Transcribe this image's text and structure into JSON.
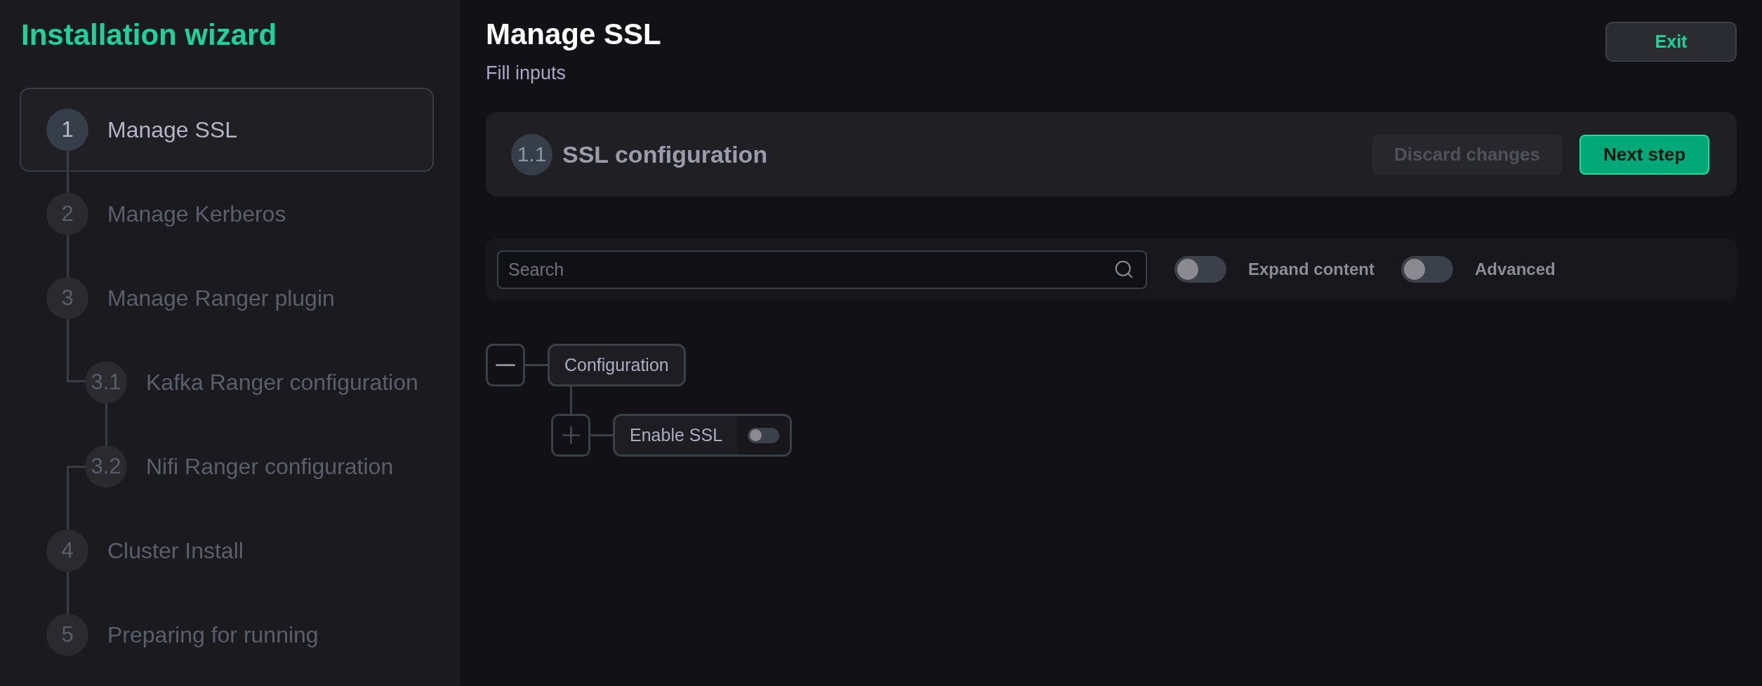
{
  "sidebar": {
    "title": "Installation wizard",
    "steps": [
      {
        "number": "1",
        "label": "Manage SSL",
        "selected": true
      },
      {
        "number": "2",
        "label": "Manage Kerberos",
        "selected": false
      },
      {
        "number": "3",
        "label": "Manage Ranger plugin",
        "selected": false,
        "children": [
          {
            "number": "3.1",
            "label": "Kafka Ranger configuration",
            "selected": false
          },
          {
            "number": "3.2",
            "label": "Nifi Ranger configuration",
            "selected": false
          }
        ]
      },
      {
        "number": "4",
        "label": "Cluster Install",
        "selected": false
      },
      {
        "number": "5",
        "label": "Preparing for running",
        "selected": false
      }
    ]
  },
  "header": {
    "title": "Manage SSL",
    "subtitle": "Fill inputs",
    "exit_button": "Exit"
  },
  "step_card": {
    "number": "1.1",
    "title": "SSL configuration",
    "discard_button": {
      "label": "Discard changes",
      "disabled": true
    },
    "next_button": {
      "label": "Next step",
      "disabled": false
    }
  },
  "filter_bar": {
    "search": {
      "placeholder": "Search"
    },
    "toggles": [
      {
        "label": "Expand content",
        "on": false
      },
      {
        "label": "Advanced",
        "on": false
      }
    ]
  },
  "tree": [
    {
      "kind": "group",
      "label": "Configuration",
      "expanded": true,
      "children": [
        {
          "kind": "switch",
          "label": "Enable SSL",
          "expanded": false,
          "on": false
        }
      ]
    }
  ]
}
